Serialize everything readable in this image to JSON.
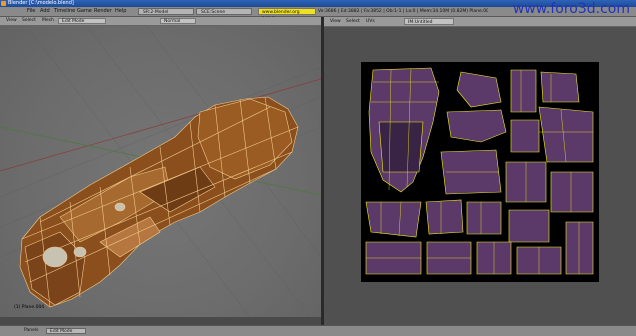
{
  "window": {
    "title": "Blender [C:\\modelo.blend]"
  },
  "watermark": "www.foro3d.com",
  "top_menu": [
    "File",
    "Add",
    "Timeline",
    "Game",
    "Render",
    "Help"
  ],
  "screens": [
    "SR:2-Model",
    "SCE:Scene"
  ],
  "version_tag": "www.blender.org 249.1",
  "stats": "Ve:3686 | Ed:3882 | Fa:3852 | Ob:1-1 | La:0 | Mem:34.10M (0.82M) Plane.004",
  "viewport3d": {
    "menus": [
      "View",
      "Select",
      "Mesh"
    ],
    "mode": "Edit Mode",
    "shading": "Normal",
    "footer": "(1) Plane.004"
  },
  "uv_editor": {
    "menus": [
      "View",
      "Select",
      "UVs"
    ],
    "image": "IM:Untitled"
  },
  "bottom": {
    "panels_label": "Panels",
    "mode": "Edit Mode"
  },
  "colors": {
    "mesh_fill": "#8a4f1c",
    "mesh_wire": "#f2c98c",
    "uv_wire": "#f2ee20",
    "uv_face": "#5b3a6a",
    "watermark": "#2233bb"
  },
  "icons": [
    "blender-icon",
    "grid-icon",
    "axis-icon",
    "image-icon"
  ]
}
